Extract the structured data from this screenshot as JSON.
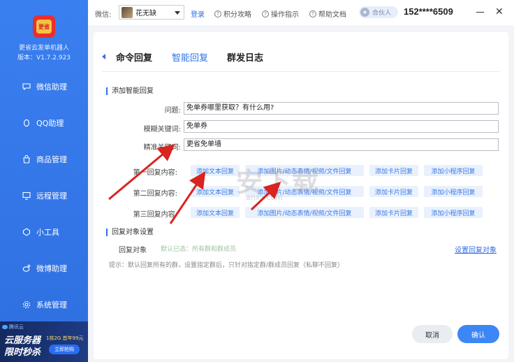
{
  "sidebar": {
    "app_name": "更省云发单机器人",
    "version": "版本：V1.7.2.923",
    "logo_text": "更省",
    "items": [
      {
        "label": "微信助理",
        "icon": "chat-icon"
      },
      {
        "label": "QQ助理",
        "icon": "penguin-icon"
      },
      {
        "label": "商品管理",
        "icon": "bag-icon"
      },
      {
        "label": "远程管理",
        "icon": "remote-icon"
      },
      {
        "label": "小工具",
        "icon": "gem-icon"
      },
      {
        "label": "微博助理",
        "icon": "weibo-icon"
      },
      {
        "label": "系统管理",
        "icon": "gear-icon"
      }
    ],
    "promo": {
      "brand": "腾讯云",
      "title_line1": "云服务器",
      "title_line2": "限时秒杀",
      "price": "1核2G 首年99元",
      "button": "立即抢购"
    }
  },
  "topbar": {
    "wechat_label": "微信:",
    "account_name": "花无缺",
    "login": "登录",
    "links": [
      "积分攻略",
      "操作指示",
      "帮助文档"
    ],
    "partner": "合伙人",
    "phone": "152****6509"
  },
  "tabs": [
    {
      "label": "命令回复",
      "active": false
    },
    {
      "label": "智能回复",
      "active": true
    },
    {
      "label": "群发日志",
      "active": false
    }
  ],
  "form": {
    "section_title": "添加智能回复",
    "question_label": "问题:",
    "question_value": "免单券哪里获取？有什么用?",
    "fuzzy_label": "模糊关键词:",
    "fuzzy_value": "免单券",
    "exact_label": "精准关键词:",
    "exact_value": "更省免单墙"
  },
  "replies": [
    {
      "label": "第一回复内容:",
      "buttons": [
        "添加文本回复",
        "添加图片/动态表情/视频/文件回复",
        "添加卡片回复",
        "添加小程序回复"
      ]
    },
    {
      "label": "第二回复内容:",
      "buttons": [
        "添加文本回复",
        "添加图片/动态表情/视频/文件回复",
        "添加卡片回复",
        "添加小程序回复"
      ]
    },
    {
      "label": "第三回复内容:",
      "buttons": [
        "添加文本回复",
        "添加图片/动态表情/视频/文件回复",
        "添加卡片回复",
        "添加小程序回复"
      ]
    }
  ],
  "target": {
    "section_title": "回复对象设置",
    "label": "回复对象",
    "value": "默认已选：所有群和群成员",
    "link": "设置回复对象",
    "hint": "提示：默认回复所有的群，设置指定群后，只针对指定群/群成员回复（私聊不回复）"
  },
  "actions": {
    "cancel": "取消",
    "confirm": "确认"
  },
  "watermark": {
    "text": "安下载",
    "sub": "anxz.com"
  },
  "colors": {
    "primary": "#3d86f5",
    "sidebar": "#2f6fe0",
    "arrow": "#d9241f"
  }
}
